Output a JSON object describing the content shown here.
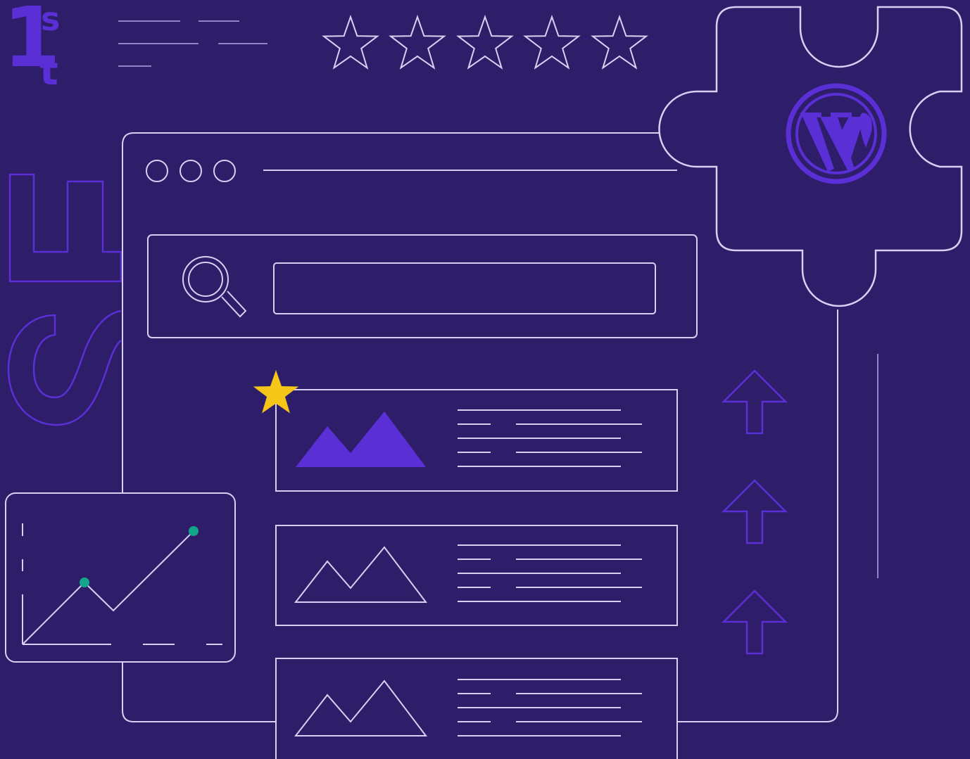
{
  "rank_badge": {
    "number": "1",
    "superscript": "s",
    "subscript": "t"
  },
  "seo_letters": [
    "S",
    "E"
  ],
  "rating": {
    "value": 0,
    "max": 5,
    "icon": "star-outline-icon"
  },
  "search": {
    "icon": "search-icon",
    "value": ""
  },
  "browser": {
    "controls": [
      "circle",
      "circle",
      "circle"
    ]
  },
  "results": [
    {
      "featured": true,
      "icon": "image-icon"
    },
    {
      "featured": false,
      "icon": "image-icon"
    },
    {
      "featured": false,
      "icon": "image-icon"
    }
  ],
  "ranking_arrows": [
    "arrow-up-icon",
    "arrow-up-icon",
    "arrow-up-icon"
  ],
  "plugin": {
    "icon": "wordpress-icon",
    "shape": "puzzle-piece-icon"
  },
  "colors": {
    "background": "#2e1d68",
    "line": "#d9cff5",
    "accent": "#5a2fd6",
    "star_featured": "#f5c518",
    "chart_dot": "#13a589"
  }
}
